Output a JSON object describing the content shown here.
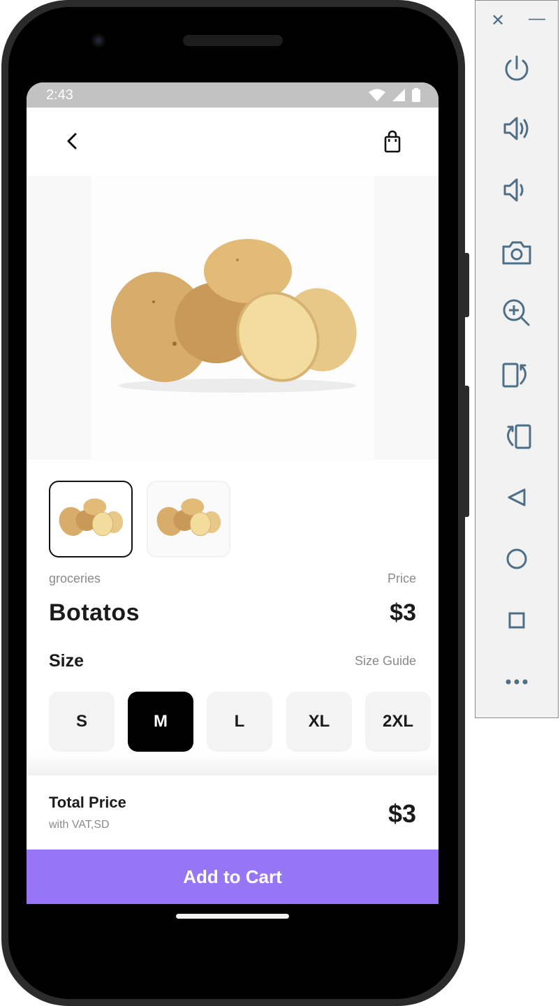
{
  "status_bar": {
    "time": "2:43"
  },
  "product": {
    "category": "groceries",
    "price_label": "Price",
    "name": "Botatos",
    "price": "$3",
    "size_title": "Size",
    "size_guide": "Size Guide",
    "sizes": [
      "S",
      "M",
      "L",
      "XL",
      "2XL"
    ],
    "selected_size": "M"
  },
  "footer": {
    "total_title": "Total Price",
    "total_sub": "with VAT,SD",
    "total_price": "$3",
    "add_to_cart": "Add to Cart"
  },
  "colors": {
    "accent": "#9676f5",
    "selected": "#000000",
    "chip": "#f3f3f3"
  },
  "emulator_panel": {
    "icons": [
      "close-icon",
      "minimize-icon",
      "power-icon",
      "volume-up-icon",
      "volume-down-icon",
      "camera-icon",
      "zoom-in-icon",
      "rotate-right-icon",
      "rotate-left-icon",
      "back-icon",
      "home-icon",
      "overview-icon",
      "more-icon"
    ]
  }
}
